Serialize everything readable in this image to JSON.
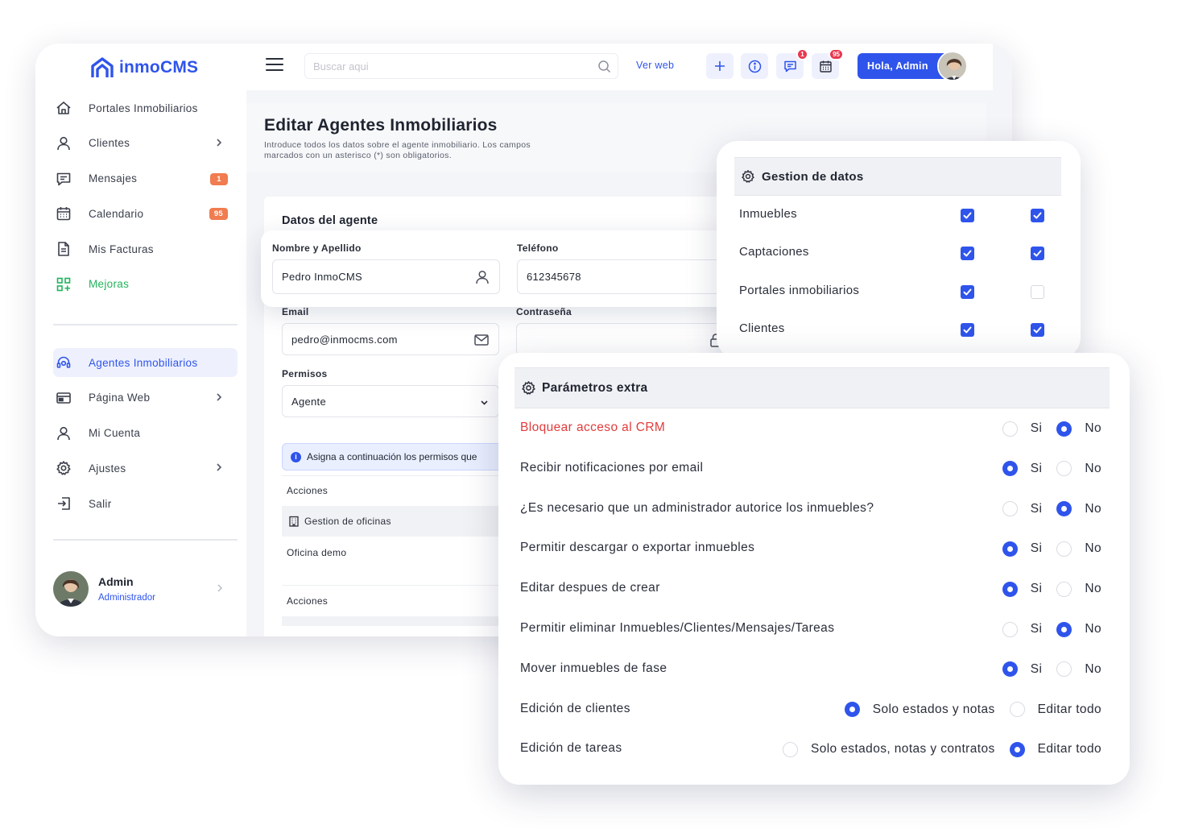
{
  "app": {
    "logo_text": "inmoCMS",
    "brand_color": "#2f54eb",
    "accent_green": "#22b35b",
    "badge_color": "#f07c4f"
  },
  "sidebar": {
    "items": [
      {
        "label": "Portales Inmobiliarios",
        "icon": "house-icon"
      },
      {
        "label": "Clientes",
        "icon": "user-icon",
        "chevron": true
      },
      {
        "label": "Mensajes",
        "icon": "message-icon",
        "badge": "1"
      },
      {
        "label": "Calendario",
        "icon": "calendar-icon",
        "badge": "95"
      },
      {
        "label": "Mis Facturas",
        "icon": "document-icon"
      },
      {
        "label": "Mejoras",
        "icon": "grid-plus-icon"
      },
      {
        "label": "Agentes Inmobiliarios",
        "icon": "headset-icon",
        "active": true
      },
      {
        "label": "Página Web",
        "icon": "browser-icon",
        "chevron": true
      },
      {
        "label": "Mi Cuenta",
        "icon": "user-icon"
      },
      {
        "label": "Ajustes",
        "icon": "gear-icon",
        "chevron": true
      },
      {
        "label": "Salir",
        "icon": "logout-icon"
      }
    ],
    "user": {
      "name": "Admin",
      "role": "Administrador"
    }
  },
  "topbar": {
    "search_placeholder": "Buscar aqui",
    "ver_web": "Ver web",
    "messages_badge": "1",
    "calendar_badge": "95",
    "greeting": "Hola, Admin"
  },
  "page": {
    "title": "Editar Agentes Inmobiliarios",
    "subtitle": "Introduce todos los datos sobre el agente inmobiliario. Los campos marcados con un asterisco (*) son obligatorios."
  },
  "form": {
    "section_title": "Datos del agente",
    "name_label": "Nombre y Apellido",
    "name_value": "Pedro InmoCMS",
    "phone_label": "Teléfono",
    "phone_value": "612345678",
    "email_label": "Email",
    "email_value": "pedro@inmocms.com",
    "password_label": "Contraseña",
    "permisos_label": "Permisos",
    "permisos_value": "Agente",
    "info_note": "Asigna a continuación los permisos que",
    "acciones_1": "Acciones",
    "gestion_oficinas": "Gestion de oficinas",
    "oficina_demo": "Oficina demo",
    "acciones_2": "Acciones"
  },
  "gestion_datos": {
    "title": "Gestion de datos",
    "rows": [
      {
        "label": "Inmuebles",
        "col1": true,
        "col2": true
      },
      {
        "label": "Captaciones",
        "col1": true,
        "col2": true
      },
      {
        "label": "Portales inmobiliarios",
        "col1": true,
        "col2": false
      },
      {
        "label": "Clientes",
        "col1": true,
        "col2": true
      }
    ]
  },
  "parametros": {
    "title": "Parámetros extra",
    "rows": [
      {
        "label": "Bloquear acceso al CRM",
        "red": true,
        "options": [
          "Si",
          "No"
        ],
        "selected": 1
      },
      {
        "label": "Recibir notificaciones por email",
        "options": [
          "Si",
          "No"
        ],
        "selected": 0
      },
      {
        "label": "¿Es necesario que un administrador autorice los inmuebles?",
        "options": [
          "Si",
          "No"
        ],
        "selected": 1
      },
      {
        "label": "Permitir descargar o exportar inmuebles",
        "options": [
          "Si",
          "No"
        ],
        "selected": 0
      },
      {
        "label": "Editar despues de crear",
        "options": [
          "Si",
          "No"
        ],
        "selected": 0
      },
      {
        "label": "Permitir eliminar Inmuebles/Clientes/Mensajes/Tareas",
        "options": [
          "Si",
          "No"
        ],
        "selected": 1
      },
      {
        "label": "Mover inmuebles de fase",
        "options": [
          "Si",
          "No"
        ],
        "selected": 0
      },
      {
        "label": "Edición de clientes",
        "options": [
          "Solo estados y notas",
          "Editar todo"
        ],
        "selected": 0
      },
      {
        "label": "Edición de tareas",
        "options": [
          "Solo estados, notas y contratos",
          "Editar todo"
        ],
        "selected": 1
      }
    ]
  }
}
